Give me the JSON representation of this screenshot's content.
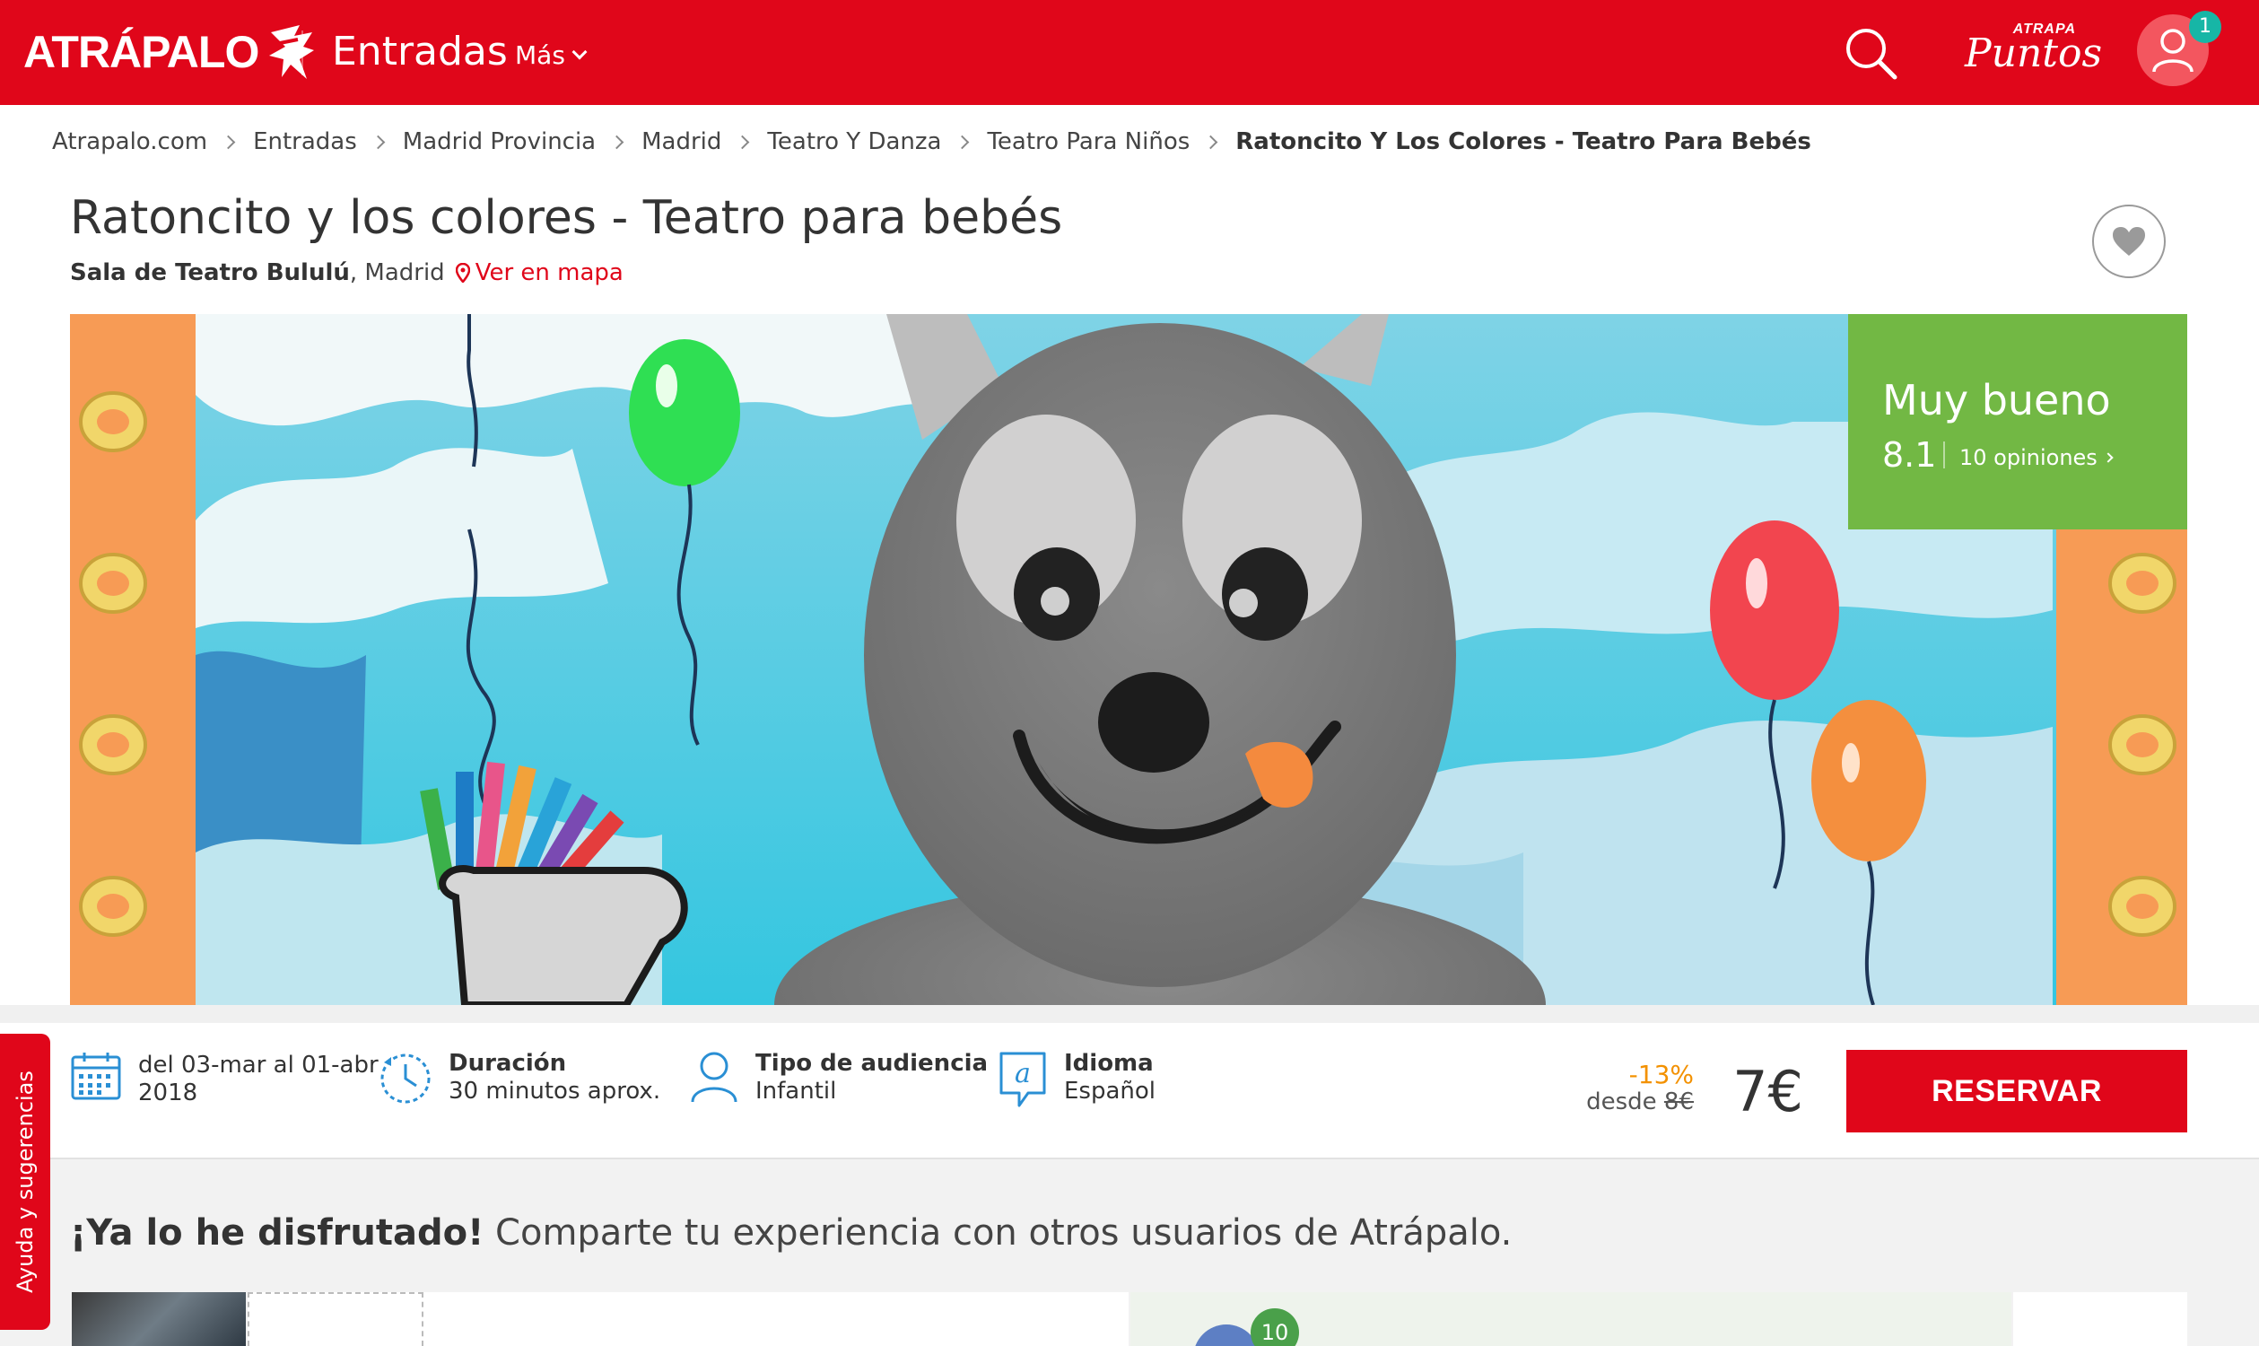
{
  "header": {
    "logo": "ATRÁPALO",
    "nav_main": "Entradas",
    "nav_more": "Más",
    "points_small": "ATRAPA",
    "points_big": "Puntos",
    "notifications": "1"
  },
  "breadcrumb": [
    "Atrapalo.com",
    "Entradas",
    "Madrid Provincia",
    "Madrid",
    "Teatro Y Danza",
    "Teatro Para Niños",
    "Ratoncito Y Los Colores - Teatro Para Bebés"
  ],
  "event": {
    "title": "Ratoncito y los colores - Teatro para bebés",
    "venue": "Sala de Teatro Bululú",
    "city": ", Madrid",
    "map_link": "Ver en mapa"
  },
  "rating": {
    "label": "Muy bueno",
    "score": "8.1",
    "opinions": "10 opiniones"
  },
  "info": {
    "dates": "del 03-mar al 01-abr 2018",
    "duration_title": "Duración",
    "duration_value": "30 minutos aprox.",
    "audience_title": "Tipo de audiencia",
    "audience_value": "Infantil",
    "language_title": "Idioma",
    "language_value": "Español"
  },
  "price": {
    "discount": "-13%",
    "from": "desde",
    "old": "8€",
    "current": "7€",
    "reserve": "RESERVAR"
  },
  "share": {
    "bold": "¡Ya lo he disfrutado!",
    "rest": "Comparte tu experiencia con otros usuarios de Atrápalo.",
    "count": "10"
  },
  "help_tab": "Ayuda y sugerencias",
  "colors": {
    "brand_red": "#e0061a",
    "rating_green": "#72b844",
    "discount_orange": "#f39100"
  }
}
